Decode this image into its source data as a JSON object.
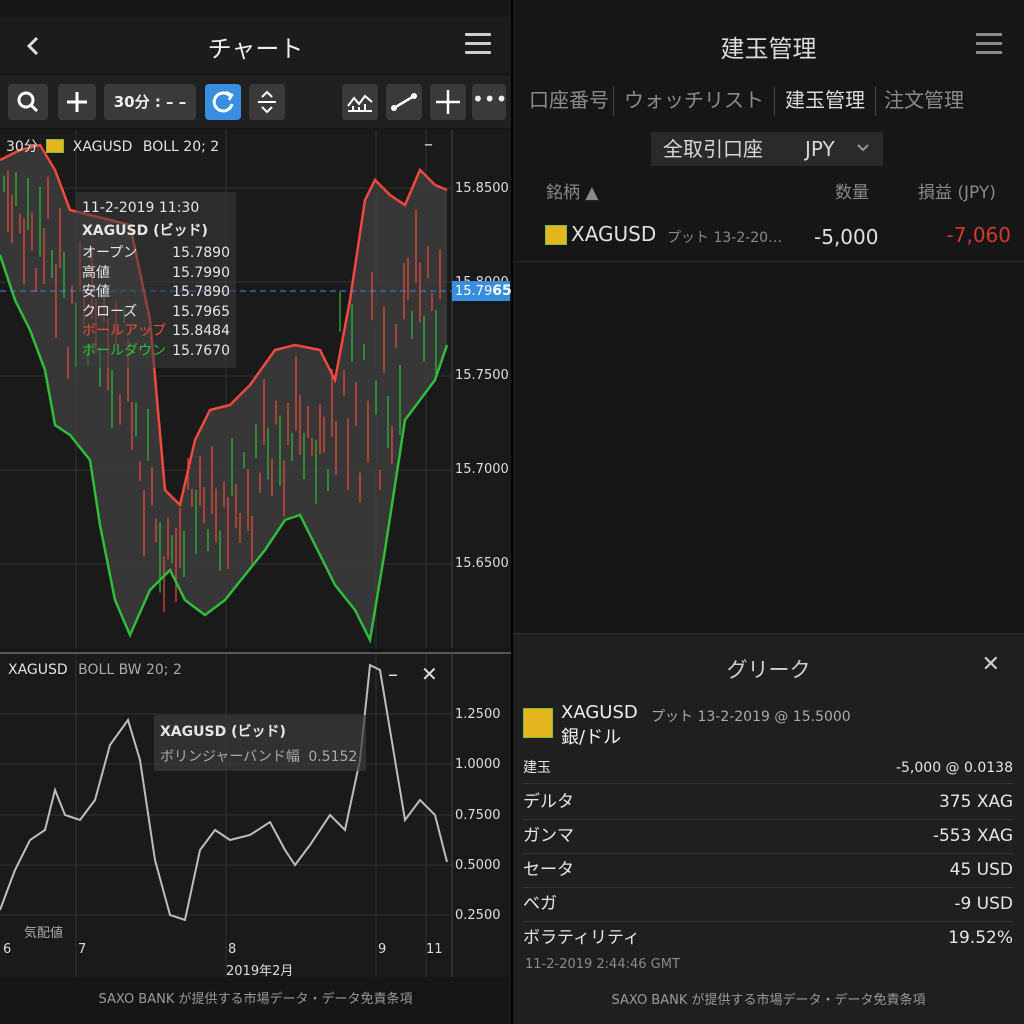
{
  "left": {
    "title": "チャート",
    "toolbar": {
      "timeframe": "30分 : – –"
    },
    "chart": {
      "timeframe_tag": "30分",
      "symbol": "XAGUSD",
      "indicator": "BOLL 20; 2",
      "collapse": "–",
      "price_labels": [
        "15.8500",
        "15.8000",
        "15.7500",
        "15.7000",
        "15.6500"
      ],
      "current_price_prefix": "15.79",
      "current_price_suffix": "65",
      "tooltip": {
        "datetime": "11-2-2019 11:30",
        "symbol_side": "XAGUSD (ビッド)",
        "rows": [
          {
            "label": "オープン",
            "value": "15.7890"
          },
          {
            "label": "高値",
            "value": "15.7990"
          },
          {
            "label": "安値",
            "value": "15.7890"
          },
          {
            "label": "クローズ",
            "value": "15.7965"
          },
          {
            "label": "ボールアップ",
            "value": "15.8484"
          },
          {
            "label": "ボールダウン",
            "value": "15.7670"
          }
        ]
      }
    },
    "indicator_panel": {
      "symbol": "XAGUSD",
      "name": "BOLL BW 20; 2",
      "collapse": "–",
      "close": "✕",
      "labels": [
        "1.2500",
        "1.0000",
        "0.7500",
        "0.5000",
        "0.2500"
      ],
      "tooltip_title": "XAGUSD (ビッド)",
      "tooltip_label": "ボリンジャーバンド幅",
      "tooltip_value": "0.5152",
      "watermark": "気配値"
    },
    "x_axis": {
      "ticks": [
        "6",
        "7",
        "8",
        "9",
        "11"
      ],
      "month": "2019年2月"
    },
    "footer": "SAXO BANK が提供する市場データ・データ免責条項",
    "colors": {
      "up": "#ef4a3c",
      "down": "#2fbd3a",
      "accent": "#3a8ee0"
    }
  },
  "right": {
    "title": "建玉管理",
    "tabs": [
      "口座番号",
      "ウォッチリスト",
      "建玉管理",
      "注文管理"
    ],
    "account": {
      "label": "全取引口座",
      "currency": "JPY"
    },
    "columns": {
      "symbol": "銘柄 ▲",
      "quantity": "数量",
      "pnl": "損益 (JPY)"
    },
    "position": {
      "symbol": "XAGUSD",
      "desc": "プット 13-2-20…",
      "quantity": "-5,000",
      "pnl": "-7,060"
    },
    "greeks": {
      "title": "グリーク",
      "close": "✕",
      "symbol": "XAGUSD",
      "desc": "プット 13-2-2019 @ 15.5000",
      "name": "銀/ドル",
      "rows": [
        {
          "label": "建玉",
          "value": "-5,000 @ 0.0138"
        },
        {
          "label": "デルタ",
          "value": "375 XAG"
        },
        {
          "label": "ガンマ",
          "value": "-553 XAG"
        },
        {
          "label": "セータ",
          "value": "45 USD"
        },
        {
          "label": "ベガ",
          "value": "-9 USD"
        },
        {
          "label": "ボラティリティ",
          "value": "19.52%"
        }
      ],
      "timestamp": "11-2-2019 2:44:46 GMT"
    },
    "footer": "SAXO BANK が提供する市場データ・データ免責条項"
  }
}
